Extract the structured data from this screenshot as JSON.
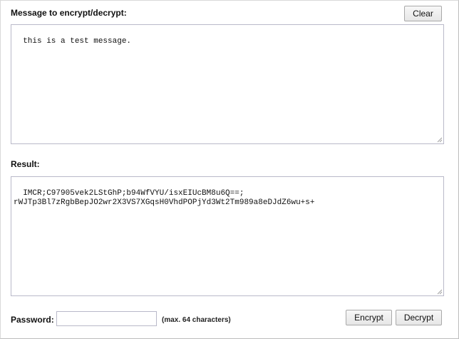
{
  "message": {
    "label": "Message to encrypt/decrypt:",
    "value": "this is a test message.",
    "clear_label": "Clear"
  },
  "result": {
    "label": "Result:",
    "value": "IMCR;C97905vek2LStGhP;b94WfVYU/isxEIUcBM8u6Q==;\nrWJTp3Bl7zRgbBepJO2wr2X3VS7XGqsH0VhdPOPjYd3Wt2Tm989a8eDJdZ6wu+s+"
  },
  "password": {
    "label": "Password:",
    "value": "",
    "hint": "(max. 64 characters)"
  },
  "actions": {
    "encrypt_label": "Encrypt",
    "decrypt_label": "Decrypt"
  }
}
